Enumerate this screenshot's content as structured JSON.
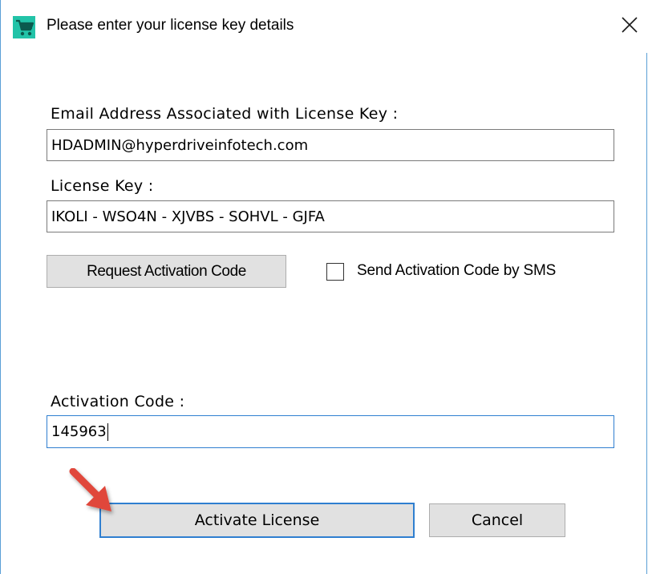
{
  "window": {
    "title": "Please enter your license key details",
    "icon": "shopping-cart-icon",
    "close_icon": "close-icon"
  },
  "form": {
    "email_label": "Email Address Associated with License Key :",
    "email_value": "HDADMIN@hyperdriveinfotech.com",
    "license_label": "License Key :",
    "license_value": "IKOLI - WSO4N - XJVBS - SOHVL - GJFA",
    "request_button": "Request Activation Code",
    "sms_checkbox_label": "Send Activation Code by SMS",
    "sms_checked": false,
    "activation_label": "Activation Code  :",
    "activation_value": "145963"
  },
  "buttons": {
    "activate": "Activate License",
    "cancel": "Cancel"
  },
  "annotation": {
    "icon": "red-arrow-icon",
    "color": "#e0473a"
  },
  "colors": {
    "accent": "#2f7fd0",
    "button_face": "#e1e1e1",
    "window_border": "#5a9fd6"
  }
}
